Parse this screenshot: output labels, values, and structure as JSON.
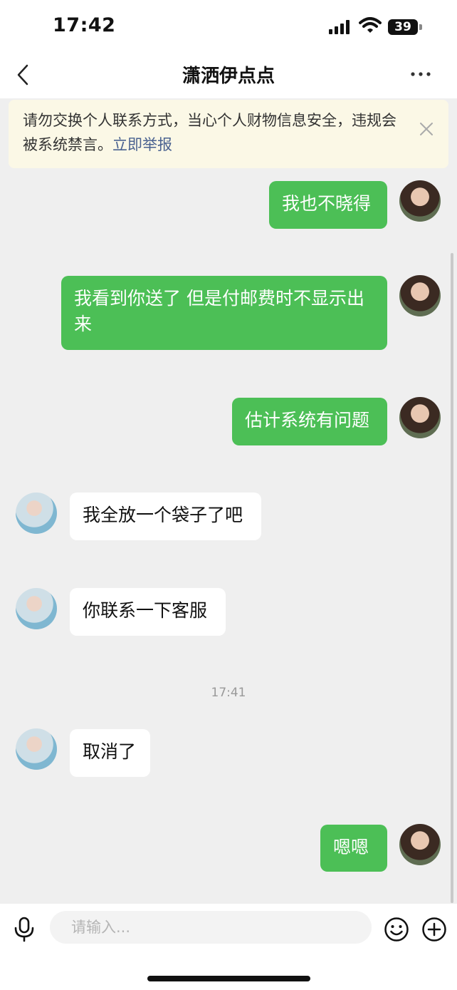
{
  "status_bar": {
    "time": "17:42",
    "battery": "39"
  },
  "nav": {
    "title": "潇洒伊点点"
  },
  "notice": {
    "text": "请勿交换个人联系方式，当心个人财物信息安全，违规会被系统禁言。",
    "link": "立即举报"
  },
  "messages": [
    {
      "sender": "self",
      "text": "我也不晓得"
    },
    {
      "sender": "self",
      "text": "我看到你送了 但是付邮费时不显示出来"
    },
    {
      "sender": "self",
      "text": "估计系统有问题"
    },
    {
      "sender": "other",
      "text": "我全放一个袋子了吧"
    },
    {
      "sender": "other",
      "text": "你联系一下客服"
    },
    {
      "sender": "other",
      "text": "取消了"
    },
    {
      "sender": "self",
      "text": "嗯嗯"
    }
  ],
  "timestamp": "17:41",
  "input": {
    "placeholder": "请输入..."
  },
  "colors": {
    "outgoing_bubble": "#4cbf56",
    "incoming_bubble": "#ffffff",
    "notice_bg": "#fbf8e6",
    "link": "#4a6290"
  },
  "icons": [
    "back-icon",
    "more-icon",
    "close-icon",
    "voice-icon",
    "emoji-icon",
    "plus-icon"
  ]
}
